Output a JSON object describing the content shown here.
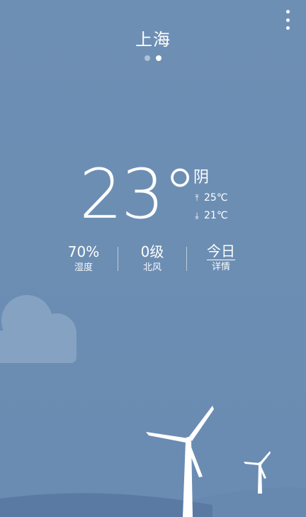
{
  "header": {
    "city": "上海",
    "menu_icon": "more-vertical-icon"
  },
  "pager": {
    "count": 2,
    "active_index": 1
  },
  "current": {
    "temperature": "23°",
    "condition": "阴",
    "high": "25℃",
    "low": "21℃",
    "high_icon": "arrow-up-icon",
    "low_icon": "arrow-down-icon"
  },
  "stats": {
    "humidity_value": "70%",
    "humidity_label": "湿度",
    "wind_value": "0级",
    "wind_label": "北风",
    "today_value": "今日",
    "today_label": "详情"
  },
  "colors": {
    "background": "#6e8fb4",
    "cloud": "#8aa3c3",
    "hill": "#5b7ba4",
    "text": "#ffffff"
  }
}
